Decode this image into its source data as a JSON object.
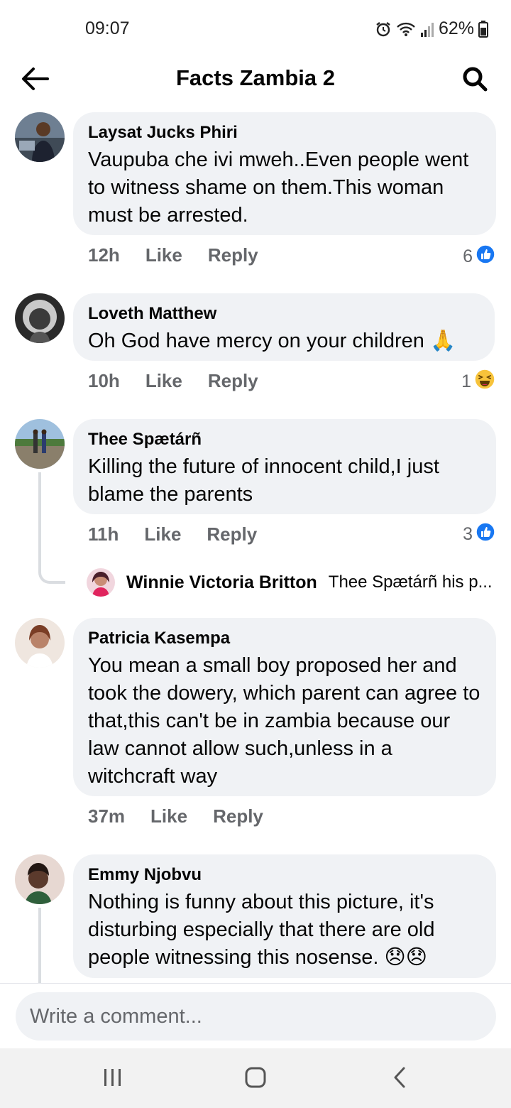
{
  "status": {
    "time": "09:07",
    "battery": "62%"
  },
  "header": {
    "title": "Facts Zambia 2",
    "back_icon": "arrow-left-icon",
    "search_icon": "search-icon"
  },
  "comments": [
    {
      "author": "Laysat Jucks Phiri",
      "text": "Vaupuba che ivi mweh..Even people went to witness shame on them.This woman must be arrested.",
      "time": "12h",
      "like": "Like",
      "reply": "Reply",
      "reaction_count": "6",
      "reaction_icon": "like-icon"
    },
    {
      "author": "Loveth Matthew",
      "text": "Oh God have mercy on your children 🙏",
      "time": "10h",
      "like": "Like",
      "reply": "Reply",
      "reaction_count": "1",
      "reaction_icon": "haha-icon"
    },
    {
      "author": "Thee Spætárñ",
      "text": "Killing the future of innocent child,I just blame the parents",
      "time": "11h",
      "like": "Like",
      "reply": "Reply",
      "reaction_count": "3",
      "reaction_icon": "like-icon"
    },
    {
      "author": "Patricia Kasempa",
      "text": "You mean a small boy proposed her and took the dowery, which parent can agree to that,this can't be in zambia because our law cannot allow such,unless in a witchcraft way",
      "time": "37m",
      "like": "Like",
      "reply": "Reply"
    },
    {
      "author": "Emmy Njobvu",
      "text": "Nothing is funny about this picture, it's disturbing especially that there are old people witnessing this nosense. 😞😞"
    }
  ],
  "reply_preview": {
    "author": "Winnie Victoria Britton",
    "text": "Thee Spætárñ his p..."
  },
  "composer": {
    "placeholder": "Write a comment..."
  },
  "nav": {
    "recents_icon": "recents-icon",
    "home_icon": "home-icon",
    "back_icon": "nav-back-icon"
  },
  "colors": {
    "bubble": "#f0f2f5",
    "secondary_text": "#65676b",
    "like_blue": "#1877f2"
  }
}
